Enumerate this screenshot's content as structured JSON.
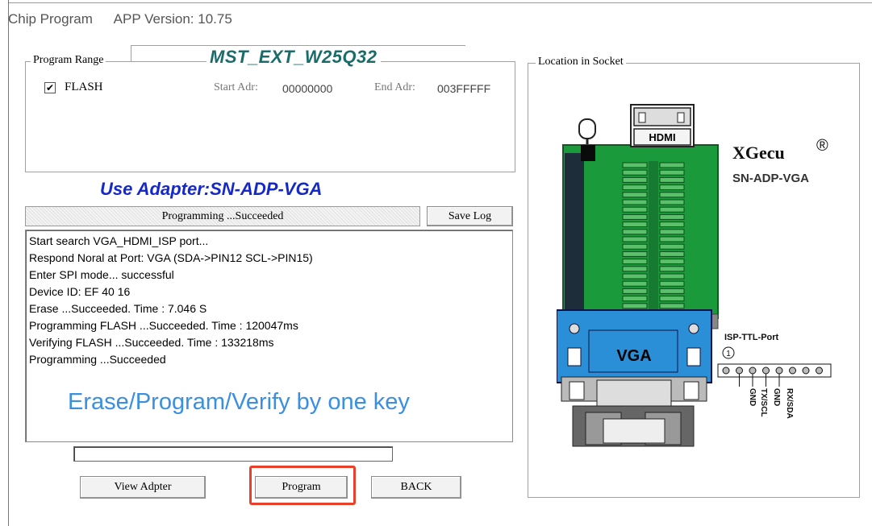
{
  "window": {
    "title": "Chip Program",
    "app_version": "APP Version: 10.75"
  },
  "program_range": {
    "label": "Program Range",
    "chip_name": "MST_EXT_W25Q32",
    "flash_checked": "✔",
    "flash_label": "FLASH",
    "start_adr_label": "Start Adr:",
    "start_adr_value": "00000000",
    "end_adr_label": "End Adr:",
    "end_adr_value": "003FFFFF"
  },
  "adapter": {
    "label": "Use Adapter:SN-ADP-VGA"
  },
  "status": {
    "text": "Programming ...Succeeded",
    "save_log": "Save Log"
  },
  "log": {
    "lines": [
      "Start search VGA_HDMI_ISP port...",
      "Respond Noral at Port: VGA (SDA->PIN12 SCL->PIN15)",
      "Enter SPI mode... successful",
      "Device ID: EF 40 16",
      "Erase  ...Succeeded. Time : 7.046 S",
      "Programming FLASH ...Succeeded. Time : 120047ms",
      "Verifying FLASH ...Succeeded. Time : 133218ms",
      "Programming  ...Succeeded"
    ],
    "caption": "Erase/Program/Verify by one key"
  },
  "progress": {
    "fraction": 0
  },
  "buttons": {
    "view_adapter": "View Adpter",
    "program": "Program",
    "back": "BACK"
  },
  "socket": {
    "label": "Location in Socket",
    "brand": "XGecu",
    "brand_mark": "®",
    "model": "SN-ADP-VGA",
    "hdmi_label": "HDMI",
    "vga_label": "VGA",
    "isp_port_label": "ISP-TTL-Port",
    "pin_one": "1",
    "pins": [
      "GND",
      "TX/SCL",
      "GND",
      "RX/SDA"
    ]
  },
  "colors": {
    "board_green": "#1a9a3a",
    "vga_blue": "#2a8fd6",
    "adapter_text": "#1529c8",
    "chip_text": "#1b6b6b",
    "caption_blue": "#3a8fe0",
    "highlight_red": "#e8402a"
  }
}
